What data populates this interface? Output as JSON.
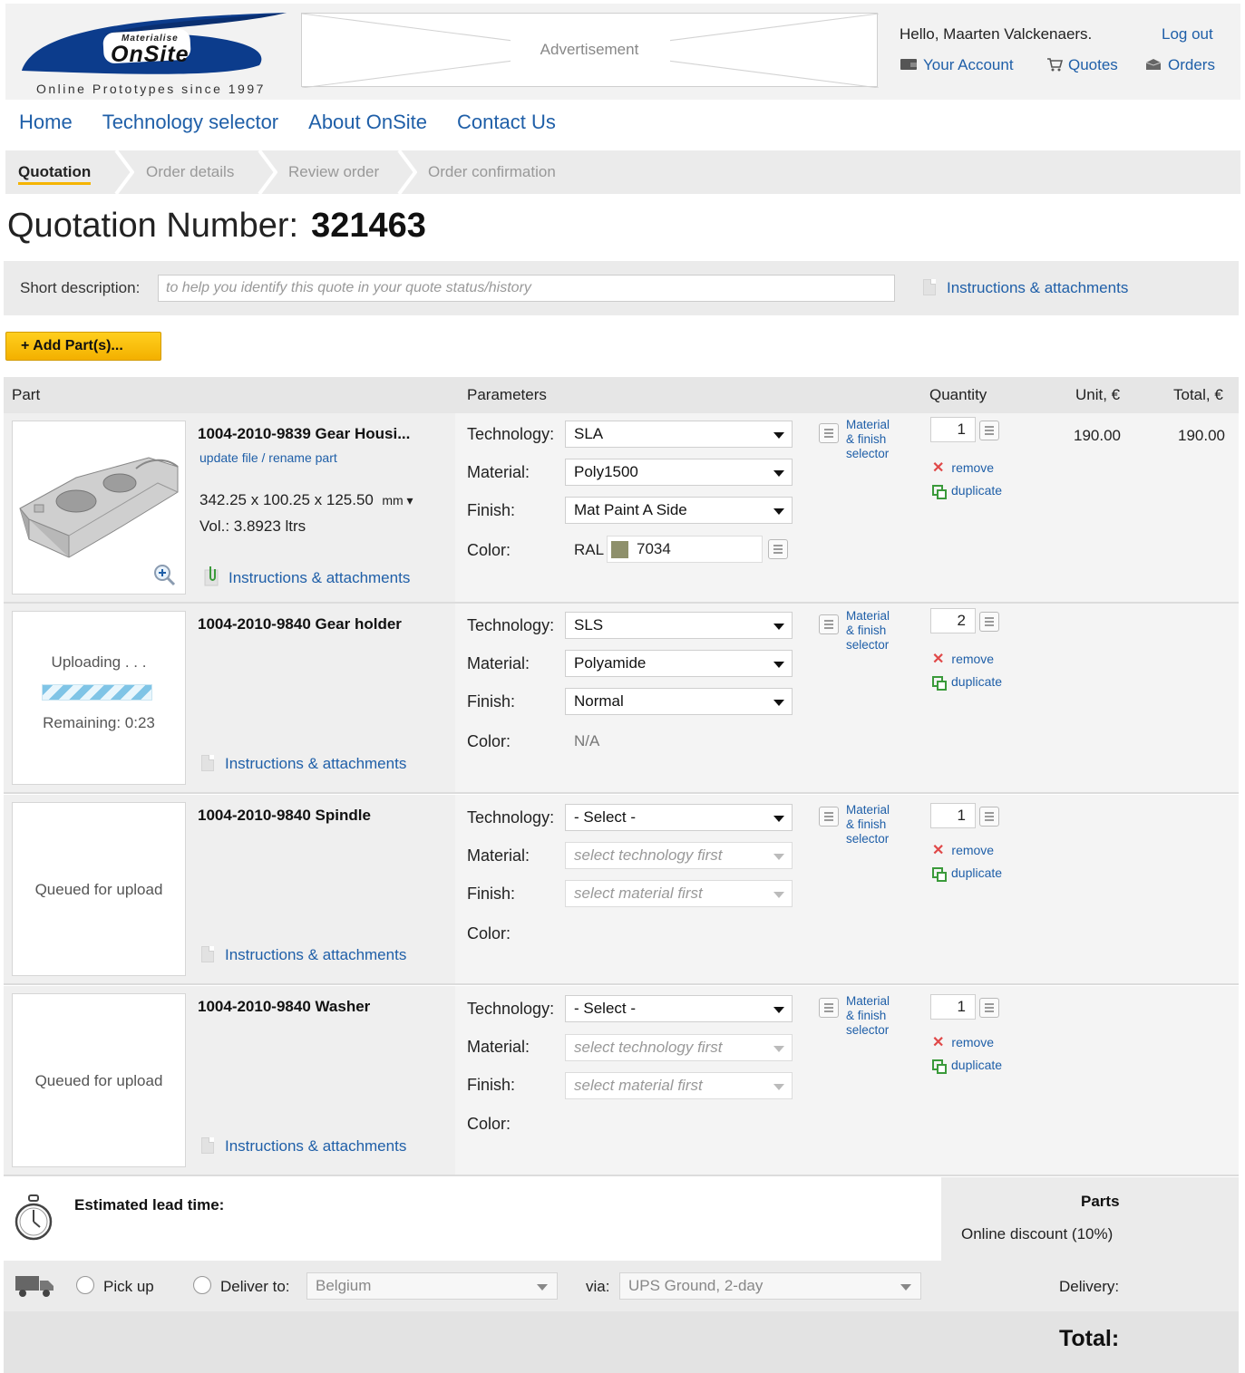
{
  "header": {
    "logo_small": "Materialise",
    "logo_big": "OnSite",
    "tagline": "Online Prototypes since 1997",
    "advertisement": "Advertisement",
    "greeting": "Hello, Maarten Valckenaers.",
    "logout": "Log out",
    "your_account": "Your Account",
    "quotes": "Quotes",
    "orders": "Orders",
    "brand_color": "#0c3c8c"
  },
  "nav": [
    "Home",
    "Technology selector",
    "About OnSite",
    "Contact Us"
  ],
  "steps": [
    "Quotation",
    "Order details",
    "Review order",
    "Order confirmation"
  ],
  "quote": {
    "label": "Quotation Number:",
    "number": "321463"
  },
  "description": {
    "label": "Short description:",
    "placeholder": "to help you identify this quote in your quote status/history",
    "value": "",
    "instructions": "Instructions & attachments"
  },
  "add_parts": "+ Add Part(s)...",
  "table_headers": {
    "part": "Part",
    "parameters": "Parameters",
    "quantity": "Quantity",
    "unit": "Unit, €",
    "total": "Total, €"
  },
  "param_labels": {
    "technology": "Technology:",
    "material": "Material:",
    "finish": "Finish:",
    "color": "Color:"
  },
  "material_finish_link": [
    "Material",
    "& finish",
    "selector"
  ],
  "actions": {
    "remove": "remove",
    "duplicate": "duplicate"
  },
  "parts": [
    {
      "name": "1004-2010-9839 Gear Housi...",
      "update_link": "update file / rename part",
      "dims": "342.25 x 100.25 x 125.50",
      "dims_unit": "mm ▾",
      "volume": "Vol.: 3.8923 ltrs",
      "instructions": "Instructions & attachments",
      "technology": "SLA",
      "material": "Poly1500",
      "finish": "Mat Paint A Side",
      "color_prefix": "RAL",
      "color_value": "7034",
      "color_swatch": "#8e906b",
      "quantity": "1",
      "unit_price": "190.00",
      "total_price": "190.00"
    },
    {
      "name": "1004-2010-9840 Gear holder",
      "status": "Uploading . . .",
      "upload_progress": 1.0,
      "remaining": "Remaining: 0:23",
      "instructions": "Instructions & attachments",
      "technology": "SLS",
      "material": "Polyamide",
      "finish": "Normal",
      "color_value": "N/A",
      "quantity": "2"
    },
    {
      "name": "1004-2010-9840 Spindle",
      "status": "Queued for upload",
      "instructions": "Instructions & attachments",
      "technology": "- Select -",
      "material": "select technology first",
      "finish": "select material first",
      "quantity": "1"
    },
    {
      "name": "1004-2010-9840 Washer",
      "status": "Queued for upload",
      "instructions": "Instructions & attachments",
      "technology": "- Select -",
      "material": "select technology first",
      "finish": "select material first",
      "quantity": "1"
    }
  ],
  "footer": {
    "lead_time": "Estimated lead time:",
    "parts": "Parts",
    "discount": "Online discount (10%)",
    "delivery": "Delivery:",
    "total": "Total:",
    "pick_up": "Pick up",
    "deliver_to": "Deliver to:",
    "country": "Belgium",
    "via": "via:",
    "shipping": "UPS Ground, 2-day"
  }
}
